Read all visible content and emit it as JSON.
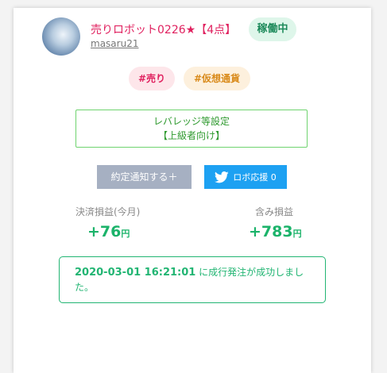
{
  "robot": {
    "title": "売りロボット0226",
    "star": "★",
    "rating": "【4点】",
    "status": "稼働中",
    "username": "masaru21"
  },
  "tags": [
    "#売り",
    "#仮想通貨"
  ],
  "leverage": {
    "line1": "レバレッジ等設定",
    "line2": "【上級者向け】"
  },
  "buttons": {
    "notify": "約定通知する＋",
    "support": "ロボ応援 0",
    "support_icon": "twitter-bird-icon"
  },
  "stats": {
    "realized_label": "決済損益(今月)",
    "realized_value": "+76",
    "realized_unit": "円",
    "unrealized_label": "含み損益",
    "unrealized_value": "+783",
    "unrealized_unit": "円"
  },
  "log": {
    "timestamp": "2020-03-01 16:21:01",
    "message": " に成行発注が成功しました。"
  },
  "colors": {
    "accent_pink": "#e0215f",
    "success_green": "#22b573",
    "twitter_blue": "#1da1f2"
  }
}
